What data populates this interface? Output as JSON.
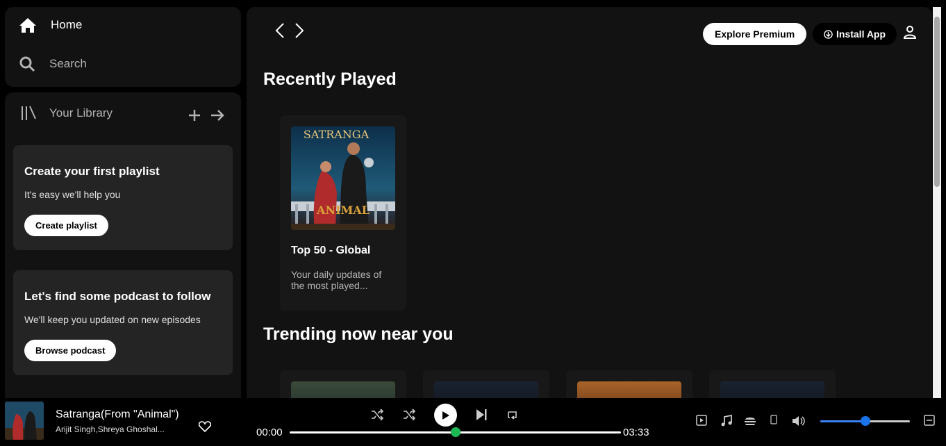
{
  "nav": {
    "home": "Home",
    "search": "Search"
  },
  "library": {
    "title": "Your Library",
    "card1": {
      "title": "Create your first playlist",
      "text": "It's easy we'll help you",
      "button": "Create playlist"
    },
    "card2": {
      "title": "Let's find some podcast to follow",
      "text": "We'll keep you updated on new episodes",
      "button": "Browse podcast"
    }
  },
  "header": {
    "premium": "Explore Premium",
    "install": "Install App"
  },
  "main": {
    "recently_played": "Recently Played",
    "album": {
      "name": "Top 50 - Global",
      "desc": "Your daily updates of the most played...",
      "art_title": "SATRANGA",
      "art_brand": "ANIMAL"
    },
    "trending": "Trending now near you"
  },
  "player": {
    "title": "Satranga(From \"Animal\")",
    "artist": "Arijit Singh,Shreya Ghoshal...",
    "current": "00:00",
    "duration": "03:33",
    "progress": 0.5,
    "volume": 0.5
  },
  "colors": {
    "accent": "#1db954",
    "volume": "#3b82f6",
    "surface": "#121212",
    "card": "#242424"
  }
}
